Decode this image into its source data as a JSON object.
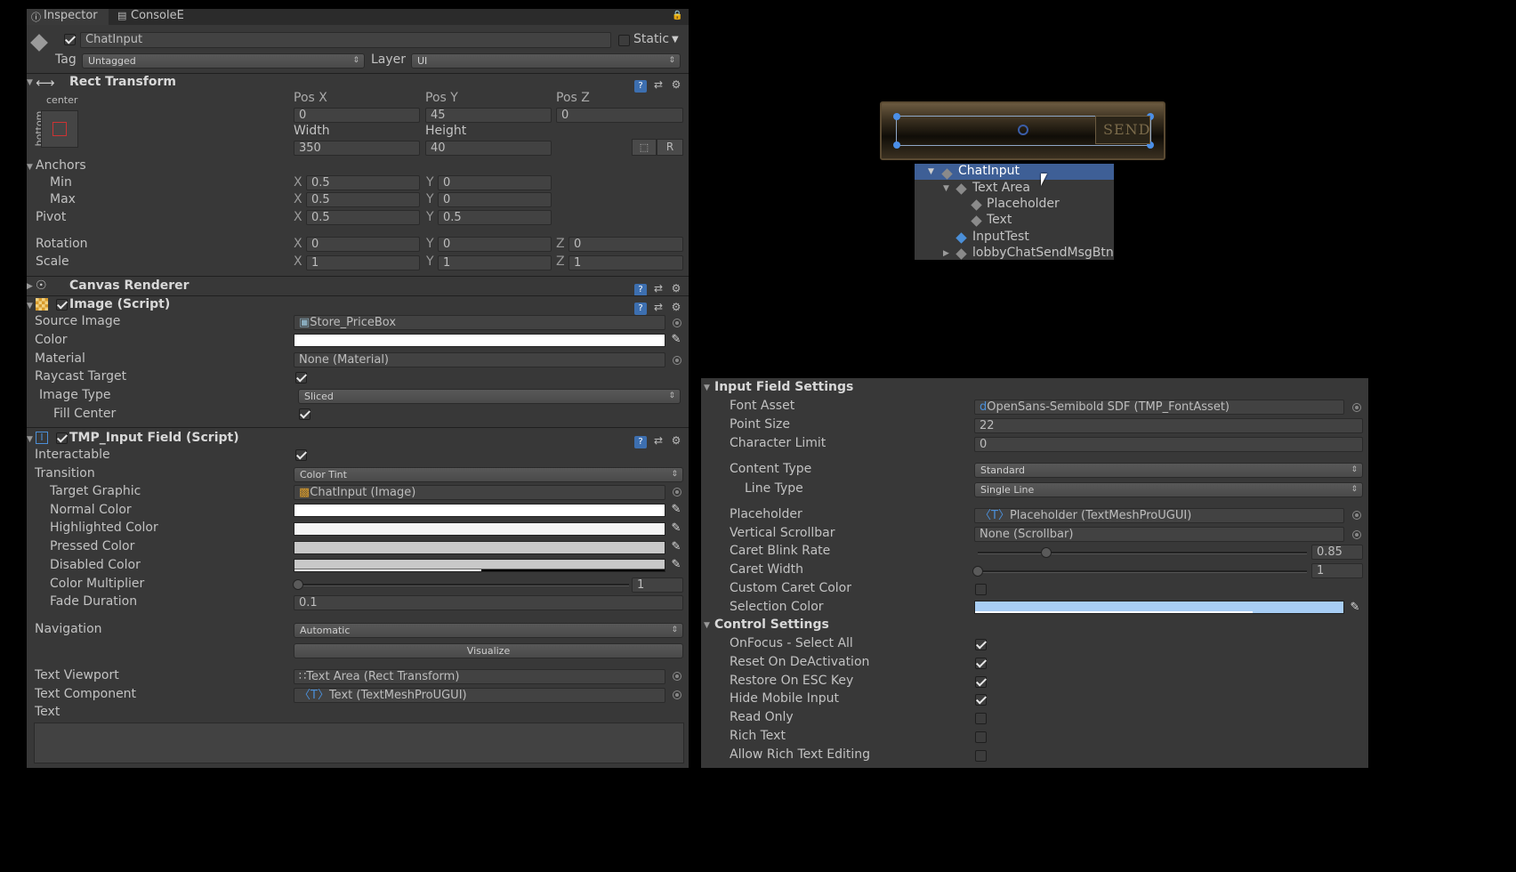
{
  "inspector": {
    "tabs": [
      {
        "label": "Inspector"
      },
      {
        "label": "ConsoleE"
      }
    ],
    "object_name": "ChatInput",
    "static_label": "Static",
    "tag_label": "Tag",
    "tag_value": "Untagged",
    "layer_label": "Layer",
    "layer_value": "UI",
    "rect_transform": {
      "title": "Rect Transform",
      "anchor_preset_top": "center",
      "anchor_preset_side": "bottom",
      "posx_label": "Pos X",
      "posy_label": "Pos Y",
      "posz_label": "Pos Z",
      "posx": "0",
      "posy": "45",
      "posz": "0",
      "width_label": "Width",
      "height_label": "Height",
      "width": "350",
      "height": "40",
      "r_button": "R",
      "anchors_label": "Anchors",
      "min_label": "Min",
      "max_label": "Max",
      "pivot_label": "Pivot",
      "min_x": "0.5",
      "min_y": "0",
      "max_x": "0.5",
      "max_y": "0",
      "pivot_x": "0.5",
      "pivot_y": "0.5",
      "rotation_label": "Rotation",
      "rot_x": "0",
      "rot_y": "0",
      "rot_z": "0",
      "scale_label": "Scale",
      "scale_x": "1",
      "scale_y": "1",
      "scale_z": "1",
      "x": "X",
      "y": "Y",
      "z": "Z"
    },
    "canvas_renderer": {
      "title": "Canvas Renderer"
    },
    "image": {
      "title": "Image (Script)",
      "source_image_label": "Source Image",
      "source_image": "Store_PriceBox",
      "color_label": "Color",
      "material_label": "Material",
      "material": "None (Material)",
      "raycast_label": "Raycast Target",
      "image_type_label": "Image Type",
      "image_type": "Sliced",
      "fill_center_label": "Fill Center"
    },
    "tmp_input": {
      "title": "TMP_Input Field (Script)",
      "interactable_label": "Interactable",
      "transition_label": "Transition",
      "transition": "Color Tint",
      "target_graphic_label": "Target Graphic",
      "target_graphic": "ChatInput (Image)",
      "normal_color_label": "Normal Color",
      "highlighted_color_label": "Highlighted Color",
      "pressed_color_label": "Pressed Color",
      "disabled_color_label": "Disabled Color",
      "color_multiplier_label": "Color Multiplier",
      "color_multiplier": "1",
      "fade_duration_label": "Fade Duration",
      "fade_duration": "0.1",
      "navigation_label": "Navigation",
      "navigation": "Automatic",
      "visualize_button": "Visualize",
      "text_viewport_label": "Text Viewport",
      "text_viewport": "Text Area (Rect Transform)",
      "text_component_label": "Text Component",
      "text_component": "Text (TextMeshProUGUI)",
      "text_label": "Text"
    }
  },
  "scene": {
    "send_label": "SEND"
  },
  "hierarchy": {
    "items": [
      {
        "label": "ChatInput"
      },
      {
        "label": "Text Area"
      },
      {
        "label": "Placeholder"
      },
      {
        "label": "Text"
      },
      {
        "label": "InputTest"
      },
      {
        "label": "lobbyChatSendMsgBtn"
      }
    ]
  },
  "settings": {
    "input_field_settings_title": "Input Field Settings",
    "font_asset_label": "Font Asset",
    "font_asset": "OpenSans-Semibold SDF (TMP_FontAsset)",
    "point_size_label": "Point Size",
    "point_size": "22",
    "char_limit_label": "Character Limit",
    "char_limit": "0",
    "content_type_label": "Content Type",
    "content_type": "Standard",
    "line_type_label": "Line Type",
    "line_type": "Single Line",
    "placeholder_label": "Placeholder",
    "placeholder": "Placeholder (TextMeshProUGUI)",
    "vertical_scrollbar_label": "Vertical Scrollbar",
    "vertical_scrollbar": "None (Scrollbar)",
    "caret_blink_label": "Caret Blink Rate",
    "caret_blink": "0.85",
    "caret_width_label": "Caret Width",
    "caret_width": "1",
    "custom_caret_label": "Custom Caret Color",
    "selection_color_label": "Selection Color",
    "control_settings_title": "Control Settings",
    "onfocus_label": "OnFocus - Select All",
    "reset_label": "Reset On DeActivation",
    "restore_label": "Restore On ESC Key",
    "hide_mobile_label": "Hide Mobile Input",
    "read_only_label": "Read Only",
    "rich_text_label": "Rich Text",
    "allow_rich_label": "Allow Rich Text Editing"
  },
  "colors": {
    "panel": "#383838",
    "selection_blue": "#3e5f96",
    "selection_color": "#a8cef5"
  }
}
